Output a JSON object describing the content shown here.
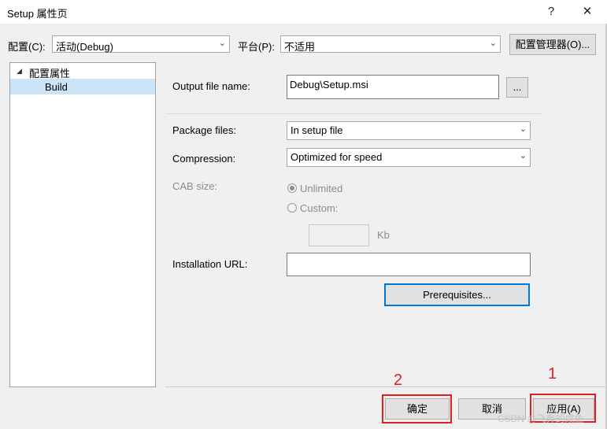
{
  "window": {
    "title": "Setup 属性页",
    "help_label": "?",
    "close_label": "✕"
  },
  "config_bar": {
    "config_label": "配置(C):",
    "config_value": "活动(Debug)",
    "platform_label": "平台(P):",
    "platform_value": "不适用",
    "manager_button": "配置管理器(O)..."
  },
  "tree": {
    "root_toggle": "◢",
    "root_label": "配置属性",
    "child_label": "Build"
  },
  "form": {
    "output_label": "Output file name:",
    "output_value": "Debug\\Setup.msi",
    "browse_button": "...",
    "package_label": "Package files:",
    "package_value": "In setup file",
    "compression_label": "Compression:",
    "compression_value": "Optimized for speed",
    "cab_label": "CAB size:",
    "unlimited_label": "Unlimited",
    "custom_label": "Custom:",
    "custom_value": "",
    "kb_label": "Kb",
    "install_url_label": "Installation URL:",
    "install_url_value": "",
    "prereq_button": "Prerequisites..."
  },
  "footer": {
    "ok_button": "确定",
    "cancel_button": "取消",
    "apply_button": "应用(A)",
    "annotation_1": "1",
    "annotation_2": "2",
    "watermark": "CSDN @飞奔的咸鱼"
  },
  "colors": {
    "annotation_red": "#e02020",
    "selection": "#cce4f7",
    "button_focus": "#0078d7"
  }
}
